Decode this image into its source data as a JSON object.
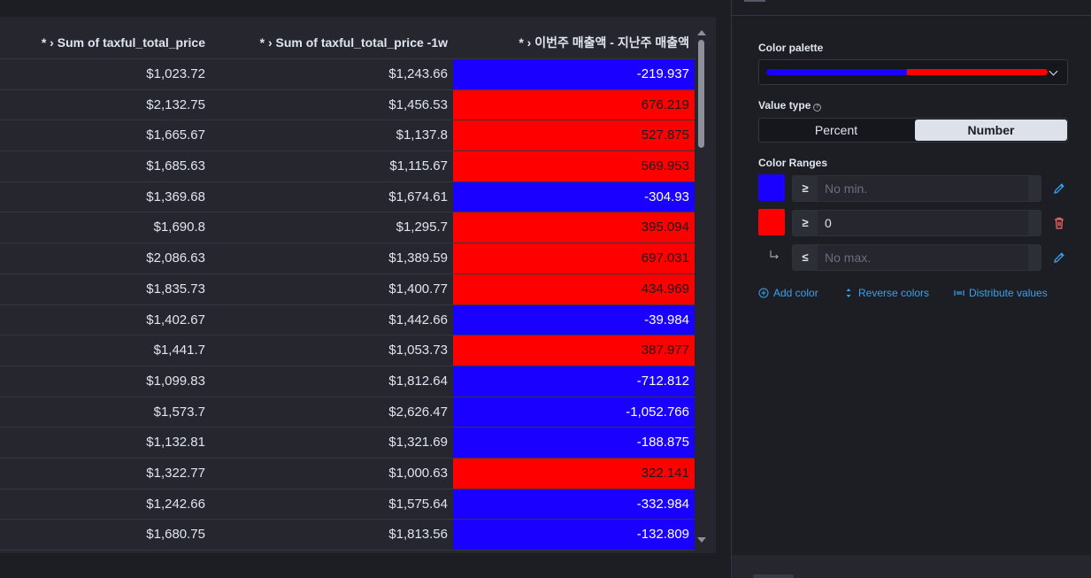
{
  "table": {
    "headers": [
      "* › Sum of taxful_total_price",
      "* › Sum of taxful_total_price -1w",
      "* › 이번주 매출액 - 지난주 매출액"
    ],
    "rows": [
      {
        "c1": "$1,023.72",
        "c2": "$1,243.66",
        "c3": "-219.937",
        "color": "#1a00ff"
      },
      {
        "c1": "$2,132.75",
        "c2": "$1,456.53",
        "c3": "676.219",
        "color": "#ff0000"
      },
      {
        "c1": "$1,665.67",
        "c2": "$1,137.8",
        "c3": "527.875",
        "color": "#ff0000"
      },
      {
        "c1": "$1,685.63",
        "c2": "$1,115.67",
        "c3": "569.953",
        "color": "#ff0000"
      },
      {
        "c1": "$1,369.68",
        "c2": "$1,674.61",
        "c3": "-304.93",
        "color": "#1a00ff"
      },
      {
        "c1": "$1,690.8",
        "c2": "$1,295.7",
        "c3": "395.094",
        "color": "#ff0000"
      },
      {
        "c1": "$2,086.63",
        "c2": "$1,389.59",
        "c3": "697.031",
        "color": "#ff0000"
      },
      {
        "c1": "$1,835.73",
        "c2": "$1,400.77",
        "c3": "434.969",
        "color": "#ff0000"
      },
      {
        "c1": "$1,402.67",
        "c2": "$1,442.66",
        "c3": "-39.984",
        "color": "#1a00ff"
      },
      {
        "c1": "$1,441.7",
        "c2": "$1,053.73",
        "c3": "387.977",
        "color": "#ff0000"
      },
      {
        "c1": "$1,099.83",
        "c2": "$1,812.64",
        "c3": "-712.812",
        "color": "#1a00ff"
      },
      {
        "c1": "$1,573.7",
        "c2": "$2,626.47",
        "c3": "-1,052.766",
        "color": "#1a00ff"
      },
      {
        "c1": "$1,132.81",
        "c2": "$1,321.69",
        "c3": "-188.875",
        "color": "#1a00ff"
      },
      {
        "c1": "$1,322.77",
        "c2": "$1,000.63",
        "c3": "322.141",
        "color": "#ff0000"
      },
      {
        "c1": "$1,242.66",
        "c2": "$1,575.64",
        "c3": "-332.984",
        "color": "#1a00ff"
      },
      {
        "c1": "$1,680.75",
        "c2": "$1,813.56",
        "c3": "-132.809",
        "color": "#1a00ff"
      }
    ],
    "text_color_on_blue": "#ffffff",
    "text_color_on_red": "#1a1c21"
  },
  "editor": {
    "color_palette_label": "Color palette",
    "palette_colors": [
      "#1a00ff",
      "#ff0000"
    ],
    "value_type_label": "Value type",
    "value_type_options": [
      "Percent",
      "Number"
    ],
    "value_type_selected": "Number",
    "color_ranges_label": "Color Ranges",
    "ranges": [
      {
        "color": "#1a00ff",
        "operator": "≥",
        "placeholder": "No min.",
        "value": ""
      },
      {
        "color": "#ff0000",
        "operator": "≥",
        "placeholder": "",
        "value": "0"
      },
      {
        "operator": "≤",
        "placeholder": "No max.",
        "value": ""
      }
    ],
    "actions": {
      "add_color": "Add color",
      "reverse_colors": "Reverse colors",
      "distribute_values": "Distribute values"
    },
    "accent_color": "#36a2ef",
    "danger_color": "#f86b63"
  }
}
